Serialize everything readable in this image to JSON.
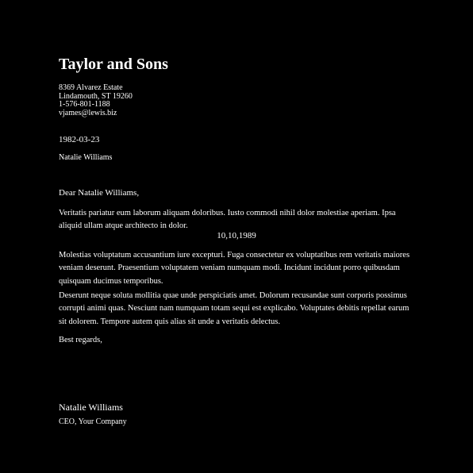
{
  "letterhead": {
    "company": "Taylor and Sons",
    "address_lines": [
      "8369 Alvarez Estate",
      "Lindamouth, ST 19260",
      "1-576-801-1188",
      "vjames@lewis.biz"
    ]
  },
  "date": "1982-03-23",
  "recipient": "Natalie Williams",
  "greeting": "Dear Natalie Williams,",
  "body": {
    "paragraph_1": "Veritatis pariatur eum laborum aliquam doloribus. Iusto commodi nihil dolor molestiae aperiam. Ipsa aliquid ullam atque architecto in dolor.",
    "center_date": "10,10,1989",
    "paragraph_2": "Molestias voluptatum accusantium iure excepturi. Fuga consectetur ex voluptatibus rem veritatis maiores veniam deserunt. Praesentium voluptatem veniam numquam modi. Incidunt incidunt porro quibusdam quisquam ducimus temporibus.",
    "paragraph_3": "Deserunt neque soluta mollitia quae unde perspiciatis amet. Dolorum recusandae sunt corporis possimus corrupti animi quas. Nesciunt nam numquam totam sequi est explicabo. Voluptates debitis repellat earum sit dolorem. Tempore autem quis alias sit unde a veritatis delectus."
  },
  "closing": "Best regards,",
  "signature": {
    "name": "Natalie Williams",
    "title": "CEO, Your Company"
  }
}
